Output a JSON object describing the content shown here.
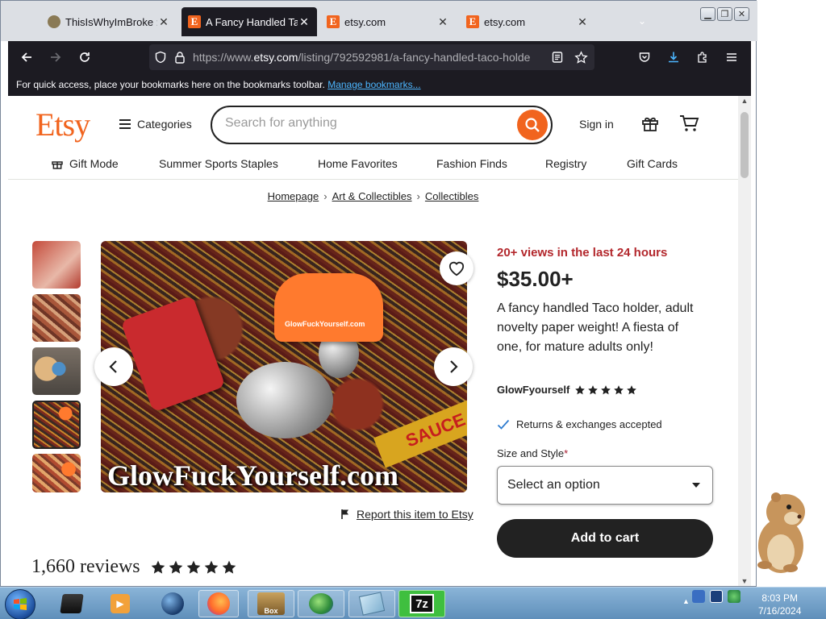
{
  "browser": {
    "tabs": [
      {
        "title": "ThisIsWhyImBroke :: T",
        "favicon": "pig-icon",
        "active": false
      },
      {
        "title": "A Fancy Handled Taco",
        "favicon": "etsy-icon",
        "active": true
      },
      {
        "title": "etsy.com",
        "favicon": "etsy-icon",
        "active": false
      },
      {
        "title": "etsy.com",
        "favicon": "etsy-icon",
        "active": false
      }
    ],
    "tab_favicon_letter": "E",
    "url_prefix": "https://www.",
    "url_domain": "etsy.com",
    "url_path": "/listing/792592981/a-fancy-handled-taco-holde",
    "bookmarks_prompt": "For quick access, place your bookmarks here on the bookmarks toolbar.",
    "bookmarks_link": "Manage bookmarks..."
  },
  "etsy": {
    "logo": "Etsy",
    "brand_color": "#f1641e",
    "categories_label": "Categories",
    "search_placeholder": "Search for anything",
    "sign_in": "Sign in",
    "nav": [
      "Gift Mode",
      "Summer Sports Staples",
      "Home Favorites",
      "Fashion Finds",
      "Registry",
      "Gift Cards"
    ],
    "breadcrumb": [
      "Homepage",
      "Art & Collectibles",
      "Collectibles"
    ]
  },
  "listing": {
    "image_watermark": "GlowFuckYourself.com",
    "image_label_text": "GlowFuckYourself.com",
    "image_sauce_text": "SAUCE",
    "report_label": "Report this item to Etsy",
    "views": "20+ views in the last 24 hours",
    "views_color": "#b3282d",
    "price": "$35.00+",
    "title": "A fancy handled Taco holder, adult novelty paper weight! A fiesta of one, for mature adults only!",
    "shop_name": "GlowFyourself",
    "shop_rating_stars": 5,
    "returns": "Returns & exchanges accepted",
    "option_label": "Size and Style",
    "option_required_mark": "*",
    "select_placeholder": "Select an option",
    "add_to_cart": "Add to cart",
    "reviews_count": "1,660 reviews",
    "reviews_stars": 5
  },
  "taskbar": {
    "time": "8:03 PM",
    "date": "7/16/2024",
    "box_label": "Box",
    "zip_label": "7z"
  }
}
